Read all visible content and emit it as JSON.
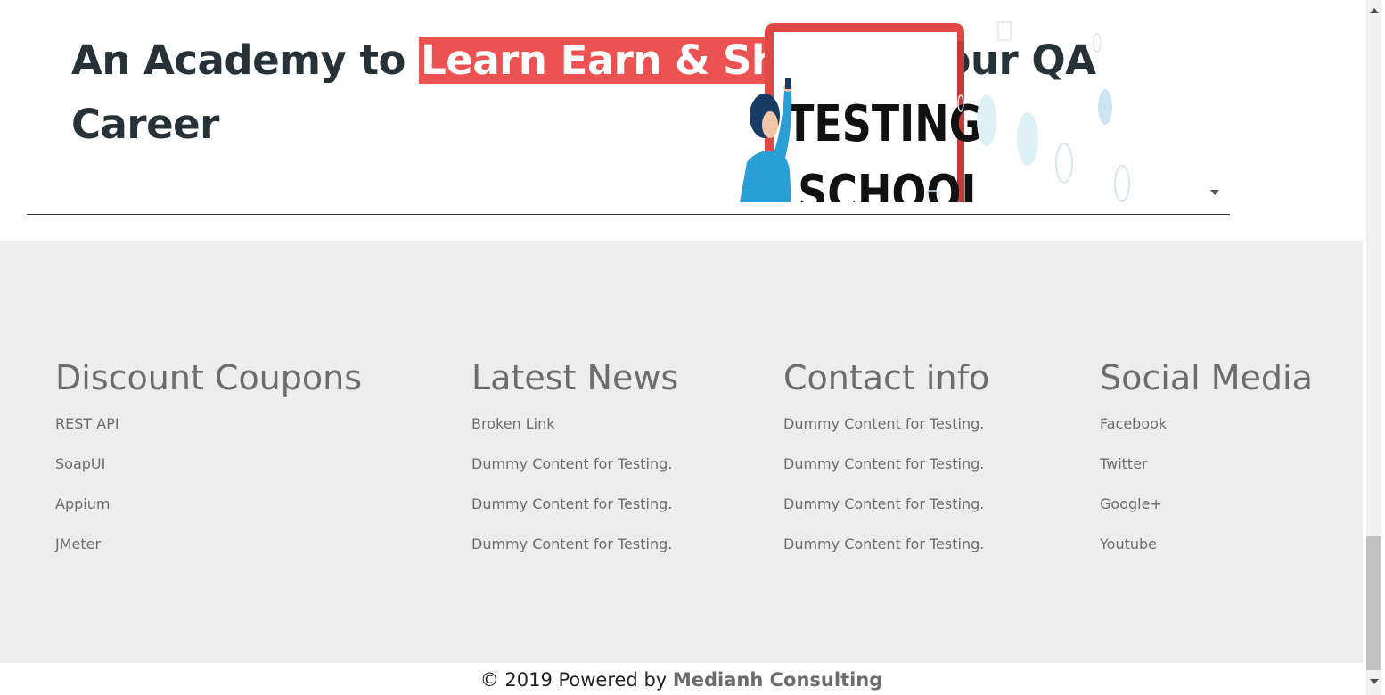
{
  "hero": {
    "title_before": "An Academy to ",
    "title_highlight": "Learn Earn & Shine",
    "title_after": "  in your QA Career",
    "image_text_line1": "TESTING",
    "image_text_line2": "SCHOOL"
  },
  "footer": {
    "columns": [
      {
        "heading": "Discount Coupons",
        "links": [
          "REST API",
          "SoapUI",
          "Appium",
          "JMeter"
        ]
      },
      {
        "heading": "Latest News",
        "links": [
          "Broken Link",
          "Dummy Content for Testing.",
          "Dummy Content for Testing.",
          "Dummy Content for Testing."
        ]
      },
      {
        "heading": "Contact info",
        "links": [
          "Dummy Content for Testing.",
          "Dummy Content for Testing.",
          "Dummy Content for Testing.",
          "Dummy Content for Testing."
        ]
      },
      {
        "heading": "Social Media",
        "links": [
          "Facebook",
          "Twitter",
          "Google+",
          "Youtube"
        ]
      }
    ],
    "copyright_prefix": "© 2019 Powered by ",
    "copyright_brand": "Medianh Consulting"
  },
  "colors": {
    "highlight": "#ec5252",
    "footer_bg": "#ededed",
    "heading_dark": "#263238",
    "footer_text": "#6c6c6c"
  }
}
